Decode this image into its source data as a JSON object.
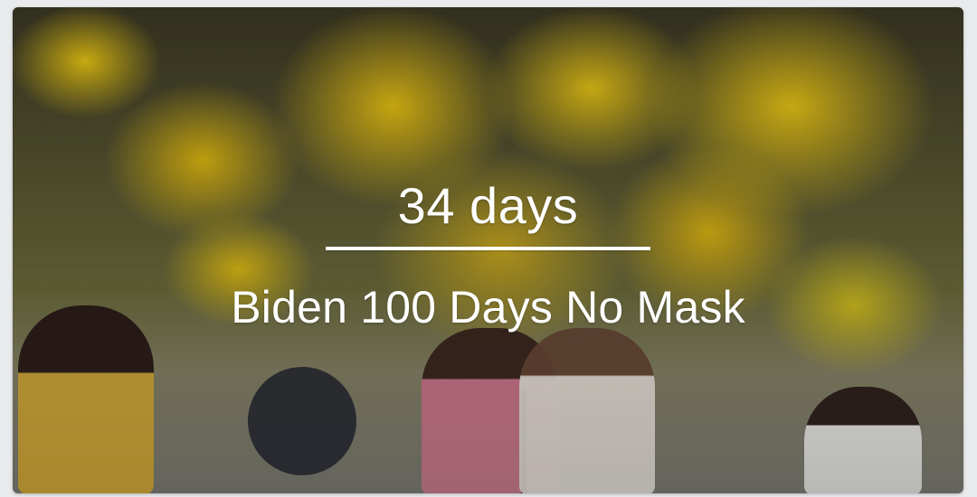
{
  "countdown": {
    "value_text": "34 days",
    "event_title": "Biden 100 Days No Mask"
  },
  "card": {
    "background_subject": "park-with-yellow-flowering-trees-and-people",
    "text_color": "#ffffff",
    "overlay_color": "#000000"
  }
}
